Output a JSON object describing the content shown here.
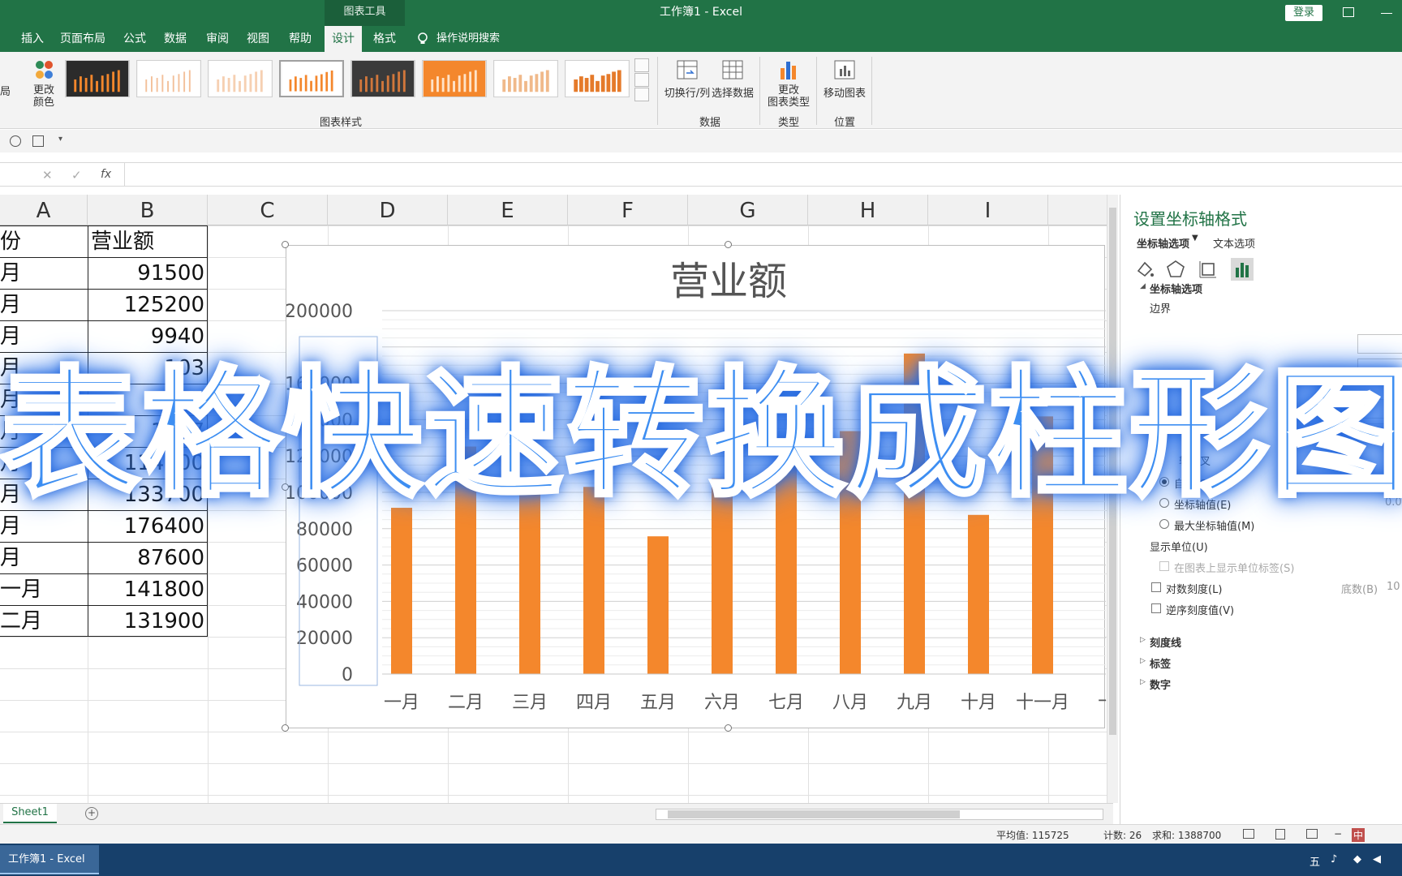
{
  "window": {
    "context_tool": "图表工具",
    "title": "工作簿1 - Excel",
    "login": "登录"
  },
  "tabs": [
    "插入",
    "页面布局",
    "公式",
    "数据",
    "审阅",
    "视图",
    "帮助",
    "设计",
    "格式"
  ],
  "active_tab": "设计",
  "tell_me": "操作说明搜索",
  "ribbon": {
    "change_colors": "更改\n颜色",
    "left_cut": "局",
    "chart_styles_group": "图表样式",
    "switch_rowcol": "切换行/列",
    "select_data": "选择数据",
    "data_group": "数据",
    "change_type": "更改\n图表类型",
    "type_group": "类型",
    "move_chart": "移动图表",
    "location_group": "位置"
  },
  "formula_bar": {
    "cancel": "✕",
    "enter": "✓",
    "fx": "fx",
    "value": ""
  },
  "columns": [
    "A",
    "B",
    "C",
    "D",
    "E",
    "F",
    "G",
    "H",
    "I"
  ],
  "table": {
    "header_a": "份",
    "header_b": "营业额",
    "rows": [
      {
        "a": "月",
        "b": "91500"
      },
      {
        "a": "月",
        "b": "125200"
      },
      {
        "a": "月",
        "b": "9940"
      },
      {
        "a": "月",
        "b": "103"
      },
      {
        "a": "月",
        "b": "75"
      },
      {
        "a": "月",
        "b": "1077"
      },
      {
        "a": "月",
        "b": "114500"
      },
      {
        "a": "月",
        "b": "133700"
      },
      {
        "a": "月",
        "b": "176400"
      },
      {
        "a": "月",
        "b": "87600"
      },
      {
        "a": "一月",
        "b": "141800"
      },
      {
        "a": "二月",
        "b": "131900"
      }
    ]
  },
  "chart_data": {
    "type": "bar",
    "title": "营业额",
    "categories": [
      "一月",
      "二月",
      "三月",
      "四月",
      "五月",
      "六月",
      "七月",
      "八月",
      "九月",
      "十月",
      "十一月",
      "十"
    ],
    "values": [
      91500,
      125200,
      99400,
      103000,
      75800,
      107700,
      114500,
      133700,
      176400,
      87600,
      141800,
      131900
    ],
    "y_ticks": [
      "0",
      "20000",
      "40000",
      "60000",
      "80000",
      "100000",
      "120000",
      "140000",
      "160000",
      "200000"
    ],
    "ylim": [
      0,
      200000
    ],
    "bar_color": "#f4872c",
    "grid": true
  },
  "sheet_tab": "Sheet1",
  "status": {
    "average": "平均值: 115725",
    "count": "计数: 26",
    "sum": "求和: 1388700",
    "ime": "中"
  },
  "taskbar": {
    "excel_item": "工作簿1 - Excel",
    "ime": "五"
  },
  "pane": {
    "title": "设置坐标轴格式",
    "tab_axis": "坐标轴选项",
    "tab_text": "文本选项",
    "section": "坐标轴选项",
    "bounds": "边界",
    "cross_partial": "横",
    "cross_partial2": "轴交叉",
    "radio_auto": "自动(O)",
    "radio_value": "坐标轴值(E)",
    "radio_max": "最大坐标轴值(M)",
    "value_field": "0.0",
    "display_units": "显示单位(U)",
    "show_units_label": "在图表上显示单位标签(S)",
    "log_scale": "对数刻度(L)",
    "base_label": "底数(B)",
    "base_value": "10",
    "reverse": "逆序刻度值(V)",
    "tick_marks": "刻度线",
    "labels": "标签",
    "number": "数字"
  },
  "headline": "表格快速转换成柱形图",
  "colors": {
    "excel_green": "#217346",
    "headline_blue": "#3d8ef2",
    "bar_orange": "#f4872c"
  }
}
